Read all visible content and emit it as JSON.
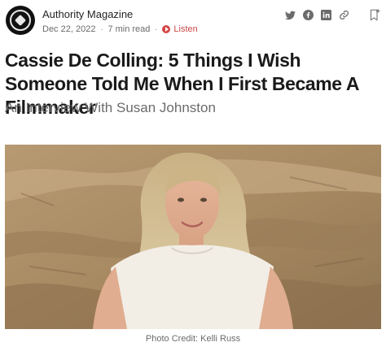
{
  "header": {
    "publication_name": "Authority Magazine",
    "date": "Dec 22, 2022",
    "read_time": "7 min read",
    "separator": "·",
    "listen_label": "Listen"
  },
  "share_icons": [
    "twitter-icon",
    "facebook-icon",
    "linkedin-icon",
    "link-icon",
    "bookmark-icon"
  ],
  "article": {
    "title": "Cassie De Colling: 5 Things I Wish Someone Told Me When I First Became A Filmmaker",
    "subtitle": "An Interview With Susan Johnston",
    "caption": "Photo Credit: Kelli Russ"
  },
  "colors": {
    "accent": "#d64545",
    "meta_text": "#6b6b6b",
    "icon": "#6b6b6b",
    "title_text": "#1a1a1a"
  }
}
